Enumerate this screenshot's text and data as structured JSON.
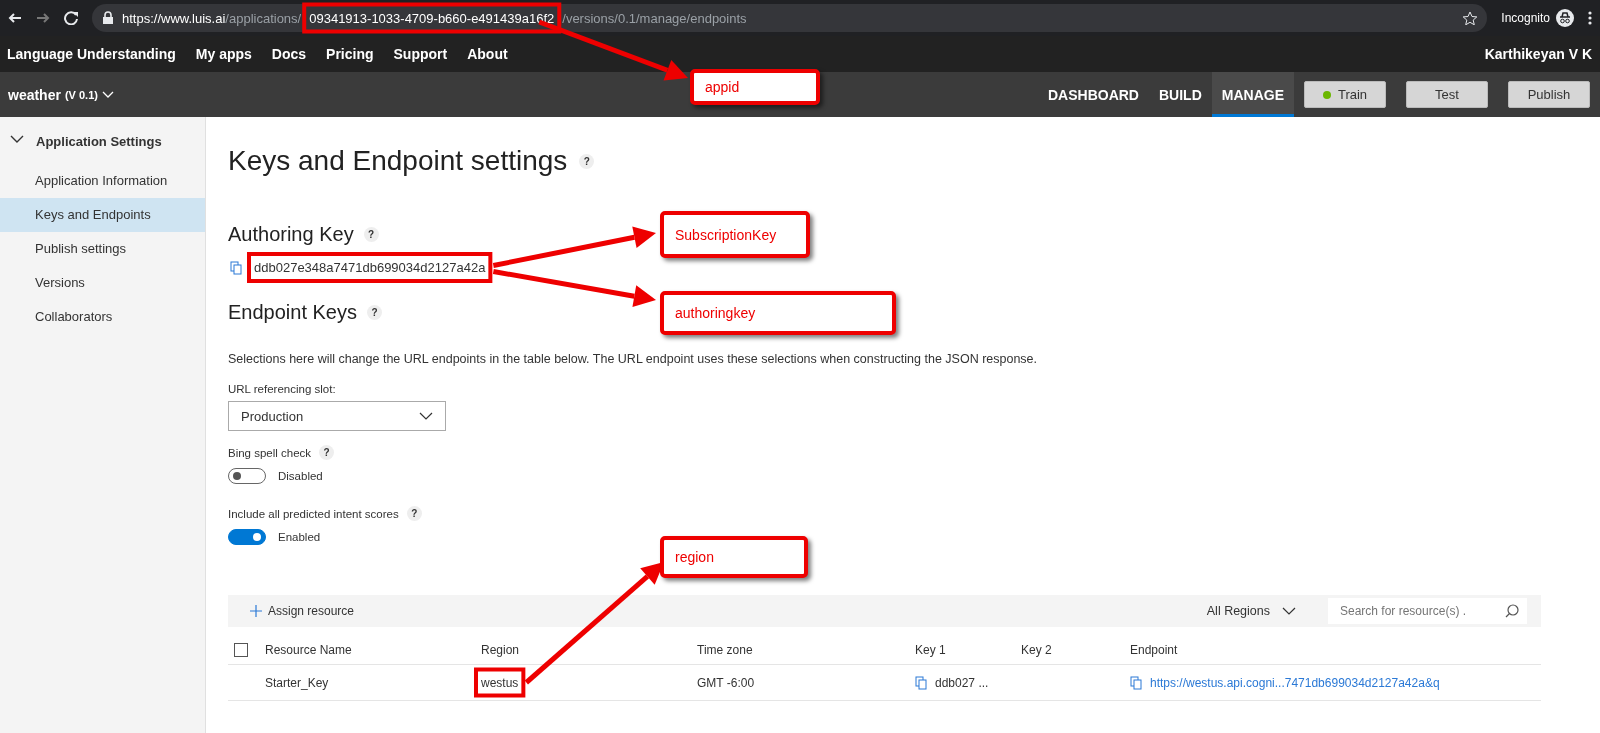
{
  "browser": {
    "url_host": "https://www.luis.ai",
    "url_prefix": "/applications/",
    "url_appid": "09341913-1033-4709-b660-e491439a16f2",
    "url_suffix": "/versions/0.1/manage/endpoints",
    "profile_label": "Incognito"
  },
  "nav": {
    "items": [
      "Language Understanding",
      "My apps",
      "Docs",
      "Pricing",
      "Support",
      "About"
    ],
    "user": "Karthikeyan V K"
  },
  "app_bar": {
    "app_name": "weather",
    "version": "(V 0.1)",
    "tabs": [
      {
        "label": "DASHBOARD",
        "selected": false
      },
      {
        "label": "BUILD",
        "selected": false
      },
      {
        "label": "MANAGE",
        "selected": true
      }
    ],
    "buttons": [
      {
        "label": "Train",
        "kind": "status"
      },
      {
        "label": "Test",
        "kind": "plain"
      },
      {
        "label": "Publish",
        "kind": "plain"
      }
    ]
  },
  "sidebar": {
    "section": "Application Settings",
    "expanded": true,
    "items": [
      {
        "label": "Application Information",
        "selected": false
      },
      {
        "label": "Keys and Endpoints",
        "selected": true
      },
      {
        "label": "Publish settings",
        "selected": false
      },
      {
        "label": "Versions",
        "selected": false
      },
      {
        "label": "Collaborators",
        "selected": false
      }
    ]
  },
  "content": {
    "title": "Keys and Endpoint settings",
    "title_help": "?",
    "authoring_heading": "Authoring Key",
    "authoring_help": "?",
    "authoring_key": "ddb027e348a7471db699034d2127a42a",
    "endpoint_heading": "Endpoint Keys",
    "endpoint_help": "?",
    "description": "Selections here will change the URL endpoints in the table below. The URL endpoint uses these selections when constructing the JSON response.",
    "slot_label": "URL referencing slot:",
    "slot_value": "Production",
    "toggles": [
      {
        "label": "Bing spell check",
        "help": "?",
        "on": false,
        "state_text": "Disabled"
      },
      {
        "label": "Include all predicted intent scores",
        "help": "?",
        "on": true,
        "state_text": "Enabled"
      }
    ]
  },
  "resources": {
    "assign_button": "Assign resource",
    "region_filter": "All Regions",
    "search": {
      "placeholder": "Search for resource(s) ."
    },
    "select_all_checked": false,
    "columns": [
      "Resource Name",
      "Region",
      "Time zone",
      "Key 1",
      "Key 2",
      "Endpoint"
    ],
    "rows": [
      {
        "resource_name": "Starter_Key",
        "region": "westus",
        "time_zone": "GMT -6:00",
        "key_1": "ddb027 ...",
        "endpoint": "https://westus.api.cogni...7471db699034d2127a42a&q"
      }
    ]
  },
  "annotations": [
    {
      "label": "appid"
    },
    {
      "label": "SubscriptionKey"
    },
    {
      "label": "authoringkey"
    },
    {
      "label": "region"
    }
  ]
}
